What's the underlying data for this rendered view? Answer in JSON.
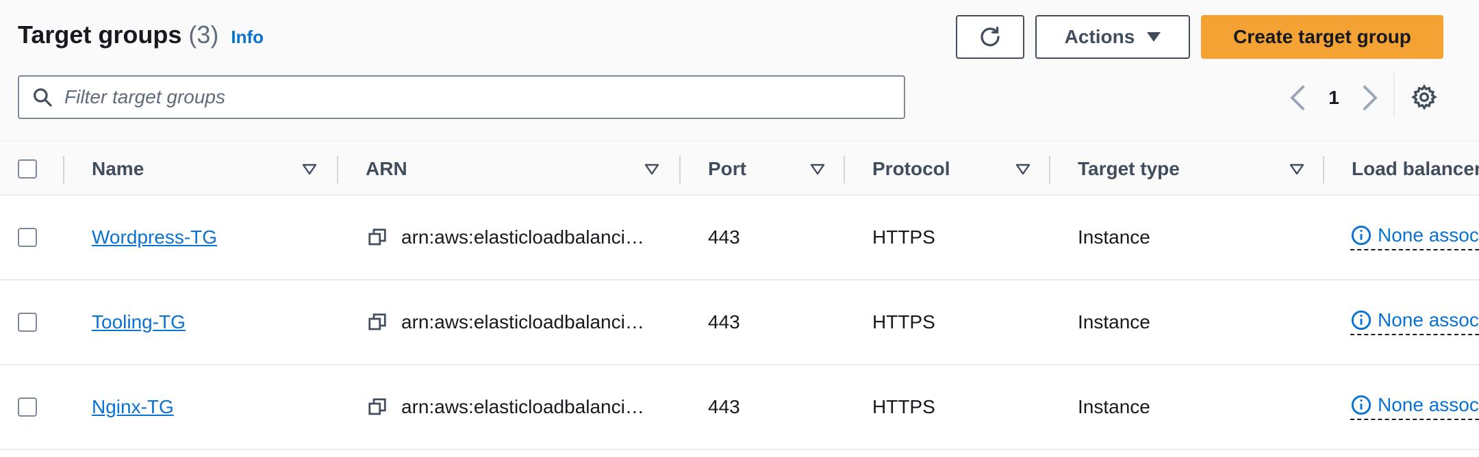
{
  "header": {
    "title": "Target groups",
    "count": "(3)",
    "info": "Info",
    "actions_label": "Actions",
    "create_label": "Create target group"
  },
  "search": {
    "placeholder": "Filter target groups",
    "value": ""
  },
  "pagination": {
    "current_page": "1"
  },
  "table": {
    "columns": [
      "Name",
      "ARN",
      "Port",
      "Protocol",
      "Target type",
      "Load balancer"
    ],
    "rows": [
      {
        "name": "Wordpress-TG",
        "arn": "arn:aws:elasticloadbalancing…",
        "port": "443",
        "protocol": "HTTPS",
        "target_type": "Instance",
        "load_balancer": "None associated"
      },
      {
        "name": "Tooling-TG",
        "arn": "arn:aws:elasticloadbalancing…",
        "port": "443",
        "protocol": "HTTPS",
        "target_type": "Instance",
        "load_balancer": "None associated"
      },
      {
        "name": "Nginx-TG",
        "arn": "arn:aws:elasticloadbalancing…",
        "port": "443",
        "protocol": "HTTPS",
        "target_type": "Instance",
        "load_balancer": "None associated"
      }
    ]
  },
  "colors": {
    "primary_button": "#f3a233",
    "link": "#0972d3",
    "border": "#414d5c",
    "header_bg": "#fafafa"
  },
  "icons": [
    "refresh-icon",
    "caret-down-icon",
    "search-icon",
    "chevron-left-icon",
    "chevron-right-icon",
    "gear-icon",
    "sort-icon",
    "copy-icon",
    "info-circle-icon"
  ]
}
